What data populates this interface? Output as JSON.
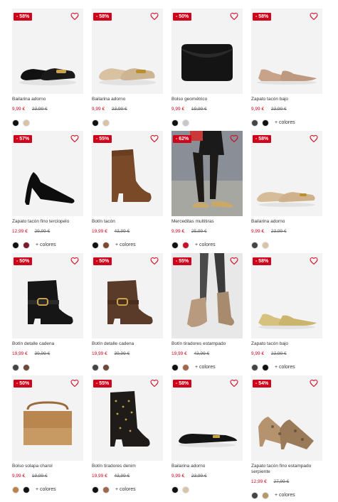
{
  "colors": {
    "sale_red": "#d0021b",
    "bg_image": "#f3f3f3"
  },
  "products": [
    {
      "discount": "- 58%",
      "name": "Bailarina adorno",
      "price": "9,99 €",
      "old_price": "23,99 €",
      "swatches": [
        "#111111",
        "#d9c4a8"
      ],
      "more": "",
      "image": "black-ballerina-flats"
    },
    {
      "discount": "- 58%",
      "name": "Bailarina adorno",
      "price": "9,99 €",
      "old_price": "23,99 €",
      "swatches": [
        "#111111",
        "#d9c4a8"
      ],
      "more": "",
      "image": "beige-ballerina-flats"
    },
    {
      "discount": "- 50%",
      "name": "Bolso geométrico",
      "price": "9,99 €",
      "old_price": "19,99 €",
      "swatches": [
        "#111111",
        "#c8c8c8"
      ],
      "more": "",
      "image": "black-clutch-bag"
    },
    {
      "discount": "- 58%",
      "name": "Zapato tacón bajo",
      "price": "9,99 €",
      "old_price": "23,99 €",
      "swatches": [
        "#444444",
        "#111111"
      ],
      "more": "+ colores",
      "image": "nude-low-heel-shoes"
    },
    {
      "discount": "- 57%",
      "name": "Zapato tacón fino terciopelo",
      "price": "12,99 €",
      "old_price": "29,99 €",
      "swatches": [
        "#111111",
        "#7a1a2a"
      ],
      "more": "+ colores",
      "image": "black-velvet-pump"
    },
    {
      "discount": "- 55%",
      "name": "Botín tacón",
      "price": "19,99 €",
      "old_price": "43,99 €",
      "swatches": [
        "#111111",
        "#7a4a2a"
      ],
      "more": "+ colores",
      "image": "brown-suede-ankle-boot"
    },
    {
      "discount": "- 62%",
      "name": "Merceditas multitiras",
      "price": "9,99 €",
      "old_price": "25,99 €",
      "swatches": [
        "#111111",
        "#c8102e"
      ],
      "more": "+ colores",
      "image": "model-strappy-mary-janes"
    },
    {
      "discount": "- 58%",
      "name": "Bailarina adorno",
      "price": "9,99 €",
      "old_price": "23,99 €",
      "swatches": [
        "#444444",
        "#d9c4a8"
      ],
      "more": "",
      "image": "beige-patent-ballerina"
    },
    {
      "discount": "- 50%",
      "name": "Botín detalle cadena",
      "price": "19,99 €",
      "old_price": "39,99 €",
      "swatches": [
        "#444444",
        "#6b4a3a"
      ],
      "more": "",
      "image": "black-chain-ankle-boot"
    },
    {
      "discount": "- 50%",
      "name": "Botín detalle cadena",
      "price": "19,99 €",
      "old_price": "39,99 €",
      "swatches": [
        "#444444",
        "#6b4a3a"
      ],
      "more": "",
      "image": "brown-chain-ankle-boot"
    },
    {
      "discount": "- 55%",
      "name": "Botín tiradores estampado",
      "price": "19,99 €",
      "old_price": "43,99 €",
      "swatches": [
        "#111111",
        "#a0684a"
      ],
      "more": "+ colores",
      "image": "model-snake-print-boots"
    },
    {
      "discount": "- 58%",
      "name": "Zapato tacón bajo",
      "price": "9,99 €",
      "old_price": "23,99 €",
      "swatches": [
        "#444444",
        "#111111"
      ],
      "more": "+ colores",
      "image": "gold-low-heel-shoes"
    },
    {
      "discount": "- 50%",
      "name": "Bolso solapa charol",
      "price": "9,99 €",
      "old_price": "19,99 €",
      "swatches": [
        "#b8844a",
        "#111111"
      ],
      "more": "+ colores",
      "image": "tan-patent-flap-bag"
    },
    {
      "discount": "- 55%",
      "name": "Botín tiradores denim",
      "price": "19,99 €",
      "old_price": "43,99 €",
      "swatches": [
        "#111111",
        "#a0684a"
      ],
      "more": "+ colores",
      "image": "studded-western-boot"
    },
    {
      "discount": "- 58%",
      "name": "Bailarina adorno",
      "price": "9,99 €",
      "old_price": "23,99 €",
      "swatches": [
        "#111111",
        "#d9c4a8"
      ],
      "more": "",
      "image": "black-pointed-ballerina"
    },
    {
      "discount": "- 54%",
      "name": "Zapato tacón fino estampado serpiente",
      "price": "12,99 €",
      "old_price": "27,99 €",
      "swatches": [
        "#444444",
        "#b8956a"
      ],
      "more": "+ colores",
      "image": "snake-print-pumps"
    }
  ]
}
